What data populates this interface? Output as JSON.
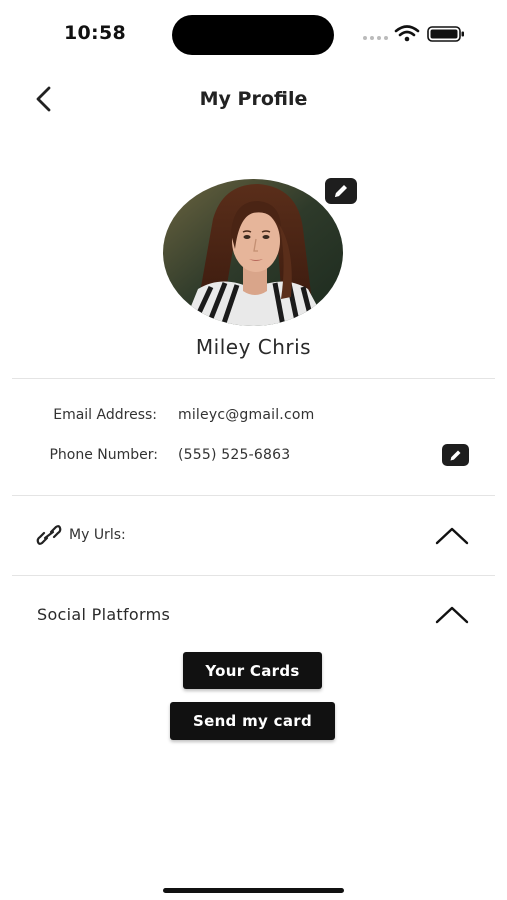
{
  "status_bar": {
    "time": "10:58"
  },
  "header": {
    "title": "My Profile",
    "back_icon": "chevron-left-icon"
  },
  "profile": {
    "name": "Miley Chris",
    "edit_icon": "pencil-icon"
  },
  "contact": {
    "email_label": "Email Address:",
    "email_value": "mileyc@gmail.com",
    "phone_label": "Phone Number:",
    "phone_value": "(555) 525-6863"
  },
  "urls": {
    "label": "My Urls:",
    "icon": "link-icon",
    "toggle_icon": "chevron-up-icon"
  },
  "social": {
    "label": "Social Platforms",
    "toggle_icon": "chevron-up-icon"
  },
  "buttons": {
    "your_cards": "Your Cards",
    "send_card": "Send my card"
  },
  "colors": {
    "button_bg": "#111111",
    "badge_bg": "#1e1e1e",
    "divider": "#e4e4e4"
  }
}
